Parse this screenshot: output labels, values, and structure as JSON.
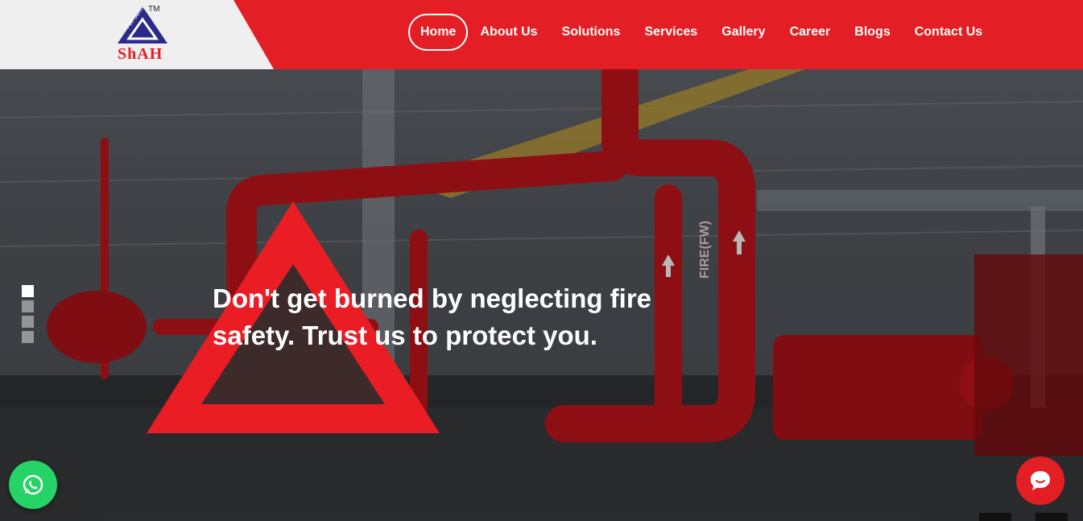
{
  "logo": {
    "brand": "ShAH",
    "arc_text": "Fire Safety",
    "tm": "TM"
  },
  "nav": {
    "items": [
      {
        "label": "Home",
        "active": true
      },
      {
        "label": "About Us"
      },
      {
        "label": "Solutions"
      },
      {
        "label": "Services"
      },
      {
        "label": "Gallery"
      },
      {
        "label": "Career"
      },
      {
        "label": "Blogs"
      },
      {
        "label": "Contact Us"
      }
    ]
  },
  "hero": {
    "headline": "Don't get burned by neglecting fire safety. Trust us to protect you.",
    "pipe_label": "FIRE(FW)",
    "slides": 4,
    "active_slide": 0
  },
  "colors": {
    "brand_red": "#e31e24",
    "logo_navy": "#2b2a8a",
    "whatsapp_green": "#25d366"
  },
  "icons": {
    "whatsapp": "whatsapp-icon",
    "chat": "chat-bubble-icon"
  }
}
